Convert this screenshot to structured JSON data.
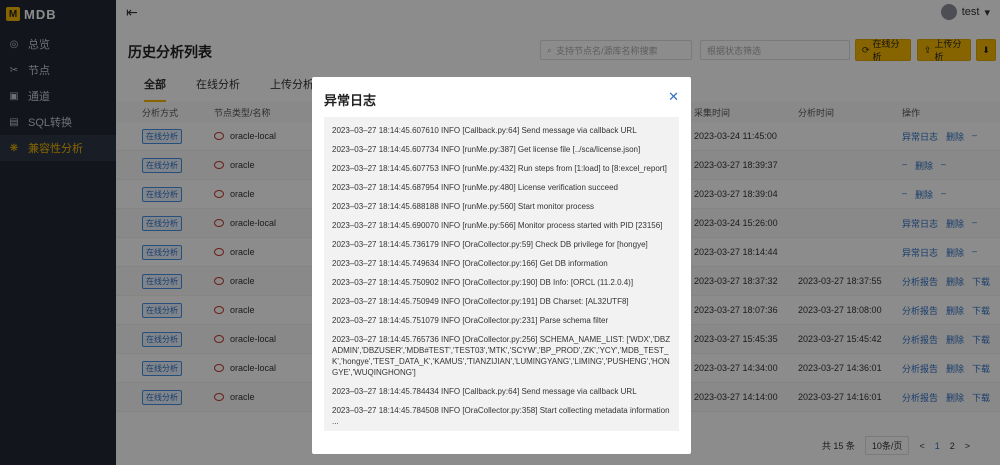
{
  "app": {
    "logo": "MDB",
    "logo_mark": "M"
  },
  "sidebar": {
    "items": [
      {
        "label": "总览",
        "icon": "dashboard-icon",
        "glyph": "◎"
      },
      {
        "label": "节点",
        "icon": "node-icon",
        "glyph": "✂"
      },
      {
        "label": "通道",
        "icon": "channel-icon",
        "glyph": "▣"
      },
      {
        "label": "SQL转换",
        "icon": "sql-icon",
        "glyph": "▤"
      },
      {
        "label": "兼容性分析",
        "icon": "compatibility-icon",
        "glyph": "❋"
      }
    ]
  },
  "header": {
    "user": "test",
    "menu_glyph": "⇤",
    "caret": "▾"
  },
  "page": {
    "title": "历史分析列表",
    "search_placeholder": "支持节点名/源库名称搜索",
    "status_placeholder": "根据状态筛选",
    "online_btn": "在线分析",
    "upload_btn": "上传分析",
    "download_glyph": "⬇"
  },
  "tabs": [
    "全部",
    "在线分析",
    "上传分析"
  ],
  "table": {
    "headers": [
      "分析方式",
      "节点类型/名称",
      "采集时间",
      "分析时间",
      "操作"
    ],
    "rows": [
      {
        "mode": "在线分析",
        "name": "oracle-local",
        "collect": "2023-03-24 11:45:00",
        "analyze": "",
        "a1": "异常日志",
        "a2": "删除",
        "a3": "–"
      },
      {
        "mode": "在线分析",
        "name": "oracle",
        "collect": "2023-03-27 18:39:37",
        "analyze": "",
        "a1": "–",
        "a2": "删除",
        "a3": "–"
      },
      {
        "mode": "在线分析",
        "name": "oracle",
        "collect": "2023-03-27 18:39:04",
        "analyze": "",
        "a1": "–",
        "a2": "删除",
        "a3": "–"
      },
      {
        "mode": "在线分析",
        "name": "oracle-local",
        "collect": "2023-03-24 15:26:00",
        "analyze": "",
        "a1": "异常日志",
        "a2": "删除",
        "a3": "–"
      },
      {
        "mode": "在线分析",
        "name": "oracle",
        "collect": "2023-03-27 18:14:44",
        "analyze": "",
        "a1": "异常日志",
        "a2": "删除",
        "a3": "–"
      },
      {
        "mode": "在线分析",
        "name": "oracle",
        "collect": "2023-03-27 18:37:32",
        "analyze": "2023-03-27 18:37:55",
        "a1": "分析报告",
        "a2": "删除",
        "a3": "下载"
      },
      {
        "mode": "在线分析",
        "name": "oracle",
        "collect": "2023-03-27 18:07:36",
        "analyze": "2023-03-27 18:08:00",
        "a1": "分析报告",
        "a2": "删除",
        "a3": "下载"
      },
      {
        "mode": "在线分析",
        "name": "oracle-local",
        "collect": "2023-03-27 15:45:35",
        "analyze": "2023-03-27 15:45:42",
        "a1": "分析报告",
        "a2": "删除",
        "a3": "下载"
      },
      {
        "mode": "在线分析",
        "name": "oracle-local",
        "collect": "2023-03-27 14:34:00",
        "analyze": "2023-03-27 14:36:01",
        "a1": "分析报告",
        "a2": "删除",
        "a3": "下载"
      },
      {
        "mode": "在线分析",
        "name": "oracle",
        "collect": "2023-03-27 14:14:00",
        "analyze": "2023-03-27 14:16:01",
        "a1": "分析报告",
        "a2": "删除",
        "a3": "下载"
      }
    ]
  },
  "pager": {
    "total": "共 15 条",
    "size": "10条/页",
    "prev": "<",
    "p1": "1",
    "p2": "2",
    "next": ">"
  },
  "modal": {
    "title": "异常日志",
    "close_glyph": "✕",
    "lines": [
      "2023–03–27 18:14:45.607610 INFO [Callback.py:64] Send message via callback URL",
      "2023–03–27 18:14:45.607734 INFO [runMe.py:387] Get license file [../sca/license.json]",
      "2023–03–27 18:14:45.607753 INFO [runMe.py:432] Run steps from [1:load] to [8:excel_report]",
      "2023–03–27 18:14:45.687954 INFO [runMe.py:480] License verification succeed",
      "2023–03–27 18:14:45.688188 INFO [runMe.py:560] Start monitor process",
      "2023–03–27 18:14:45.690070 INFO [runMe.py:566] Monitor process started with PID [23156]",
      "2023–03–27 18:14:45.736179 INFO [OraCollector.py:59] Check DB privilege for [hongye]",
      "2023–03–27 18:14:45.749634 INFO [OraCollector.py:166] Get DB information",
      "2023–03–27 18:14:45.750902 INFO [OraCollector.py:190] DB Info: [ORCL (11.2.0.4)]",
      "2023–03–27 18:14:45.750949 INFO [OraCollector.py:191] DB Charset: [AL32UTF8]",
      "2023–03–27 18:14:45.751079 INFO [OraCollector.py:231] Parse schema filter",
      "2023–03–27 18:14:45.765736 INFO [OraCollector.py:256] SCHEMA_NAME_LIST: ['WDX','DBZADMIN','DBZUSER','MDB#TEST','TEST03','MTK','SCYW','BP_PROD','ZK','YCY','MDB_TEST_K','hongye','TEST_DATA_K','KAMUS','TIANZIJIAN','LUMINGYANG','LIMING','PUSHENG','HONGYE','WUQINGHONG']",
      "2023–03–27 18:14:45.784434 INFO [Callback.py:64] Send message via callback URL",
      "2023–03–27 18:14:45.784508 INFO [OraCollector.py:358] Start collecting metadata information ..."
    ]
  }
}
